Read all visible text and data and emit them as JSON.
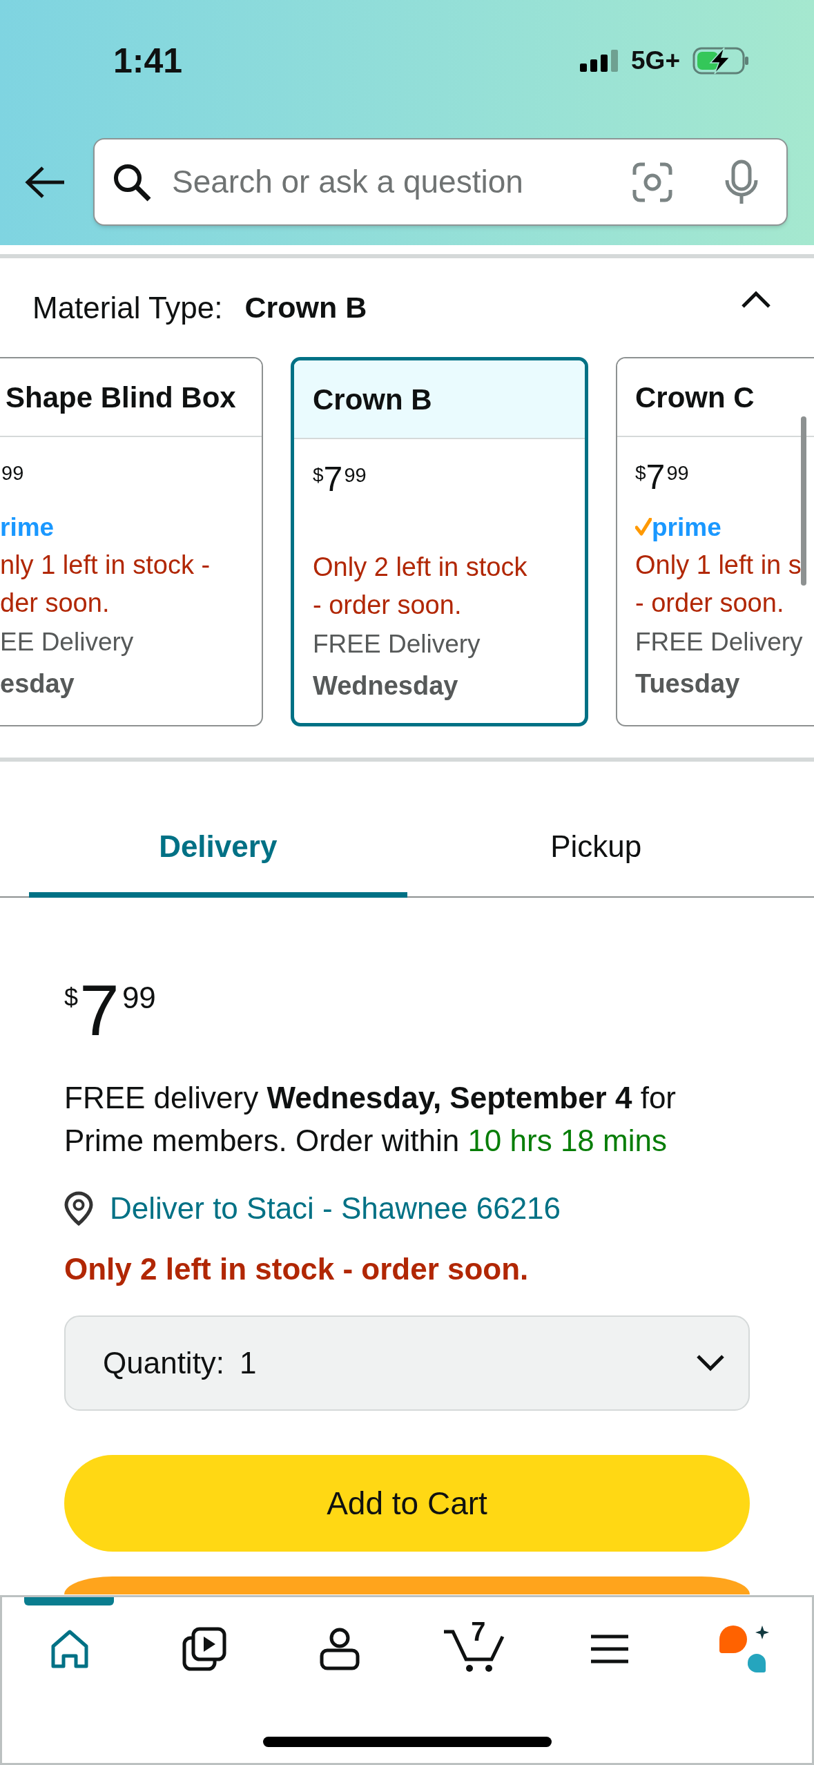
{
  "status_bar": {
    "time": "1:41",
    "network": "5G+"
  },
  "search": {
    "placeholder": "Search or ask a question"
  },
  "variation": {
    "label": "Material Type:",
    "value": "Crown B",
    "expanded": true,
    "options": [
      {
        "title": "Shape Blind Box",
        "selected": false,
        "price": {
          "fraction": "99"
        },
        "prime": {
          "text": "rime",
          "check": false
        },
        "stock": [
          "nly 1 left in stock -",
          "der soon."
        ],
        "delivery": "EE Delivery",
        "day": "esday"
      },
      {
        "title": "Crown B",
        "selected": true,
        "price": {
          "currency": "$",
          "whole": "7",
          "fraction": "99"
        },
        "stock": [
          "Only 2 left in stock",
          "- order soon."
        ],
        "delivery": "FREE Delivery",
        "day": "Wednesday"
      },
      {
        "title": "Crown C",
        "selected": false,
        "price": {
          "currency": "$",
          "whole": "7",
          "fraction": "99"
        },
        "prime": {
          "text": "prime",
          "check": true
        },
        "stock": [
          "Only 1 left in s",
          "- order soon."
        ],
        "delivery": "FREE Delivery",
        "day": "Tuesday"
      }
    ]
  },
  "tabs": [
    {
      "label": "Delivery",
      "selected": true
    },
    {
      "label": "Pickup",
      "selected": false
    }
  ],
  "offer": {
    "price": {
      "currency": "$",
      "whole": "7",
      "fraction": "99"
    },
    "message": "FREE delivery **Wednesday, September 4** for Prime members. Order within",
    "countdown": "10 hrs 18 mins",
    "location": "Deliver to Staci - Shawnee 66216",
    "stock": "Only 2 left in stock - order soon.",
    "quantity": {
      "label": "Quantity:",
      "value": "1"
    },
    "buttons": [
      {
        "kind": "cart",
        "label": "Add to Cart"
      },
      {
        "kind": "buy"
      }
    ]
  },
  "nav": {
    "items": [
      {
        "kind": "home",
        "selected": true
      },
      {
        "kind": "video",
        "selected": false
      },
      {
        "kind": "account",
        "selected": false
      },
      {
        "kind": "cart",
        "selected": false,
        "count": "7"
      },
      {
        "kind": "menu",
        "selected": false
      },
      {
        "kind": "assistant",
        "selected": false
      }
    ]
  }
}
